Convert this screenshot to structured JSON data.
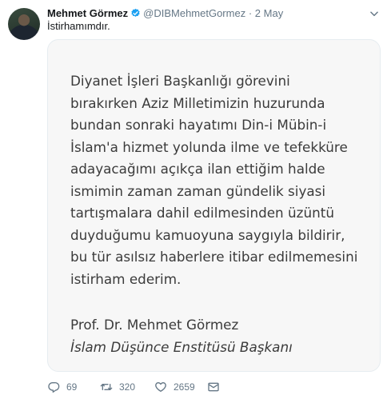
{
  "tweet": {
    "author_name": "Mehmet Görmez",
    "handle": "@DIBMehmetGormez",
    "separator": "·",
    "date": "2 May",
    "text": "İstirhamımdır."
  },
  "media": {
    "lines": [
      "Diyanet İşleri Başkanlığı görevini",
      "bırakırken Aziz Milletimizin huzurunda",
      "bundan sonraki hayatımı Din-i Mübin-i",
      "İslam'a hizmet yolunda ilme ve tefekküre",
      "adayacağımı açıkça ilan ettiğim halde",
      "ismimin zaman zaman gündelik siyasi",
      "tartışmalara dahil edilmesinden üzüntü",
      "duyduğumu kamuoyuna saygıyla bildirir,",
      "bu tür asılsız haberlere itibar edilmemesini",
      "istirham ederim."
    ],
    "signature_name": "Prof. Dr. Mehmet Görmez",
    "signature_title": "İslam Düşünce Enstitüsü Başkanı"
  },
  "actions": {
    "reply_count": "69",
    "retweet_count": "320",
    "like_count": "2659"
  },
  "icons": {
    "verified": "verified-badge-icon",
    "caret": "chevron-down-icon",
    "reply": "reply-icon",
    "retweet": "retweet-icon",
    "like": "heart-icon",
    "message": "direct-message-icon"
  },
  "colors": {
    "verified_blue": "#1da1f2",
    "muted_text": "#657786",
    "card_background": "#f7f7f7"
  }
}
